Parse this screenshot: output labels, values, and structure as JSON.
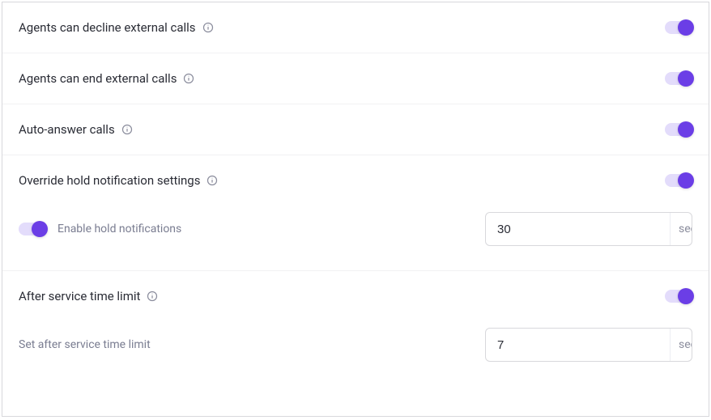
{
  "settings": [
    {
      "label": "Agents can decline external calls",
      "toggle": true
    },
    {
      "label": "Agents can end external calls",
      "toggle": true
    },
    {
      "label": "Auto-answer calls",
      "toggle": true
    },
    {
      "label": "Override hold notification settings",
      "toggle": true,
      "sub": {
        "label": "Enable hold notifications",
        "subToggle": true,
        "value": "30",
        "unit": "sec"
      }
    },
    {
      "label": "After service time limit",
      "toggle": true,
      "sub": {
        "label": "Set after service time limit",
        "value": "7",
        "unit": "sec"
      }
    }
  ]
}
